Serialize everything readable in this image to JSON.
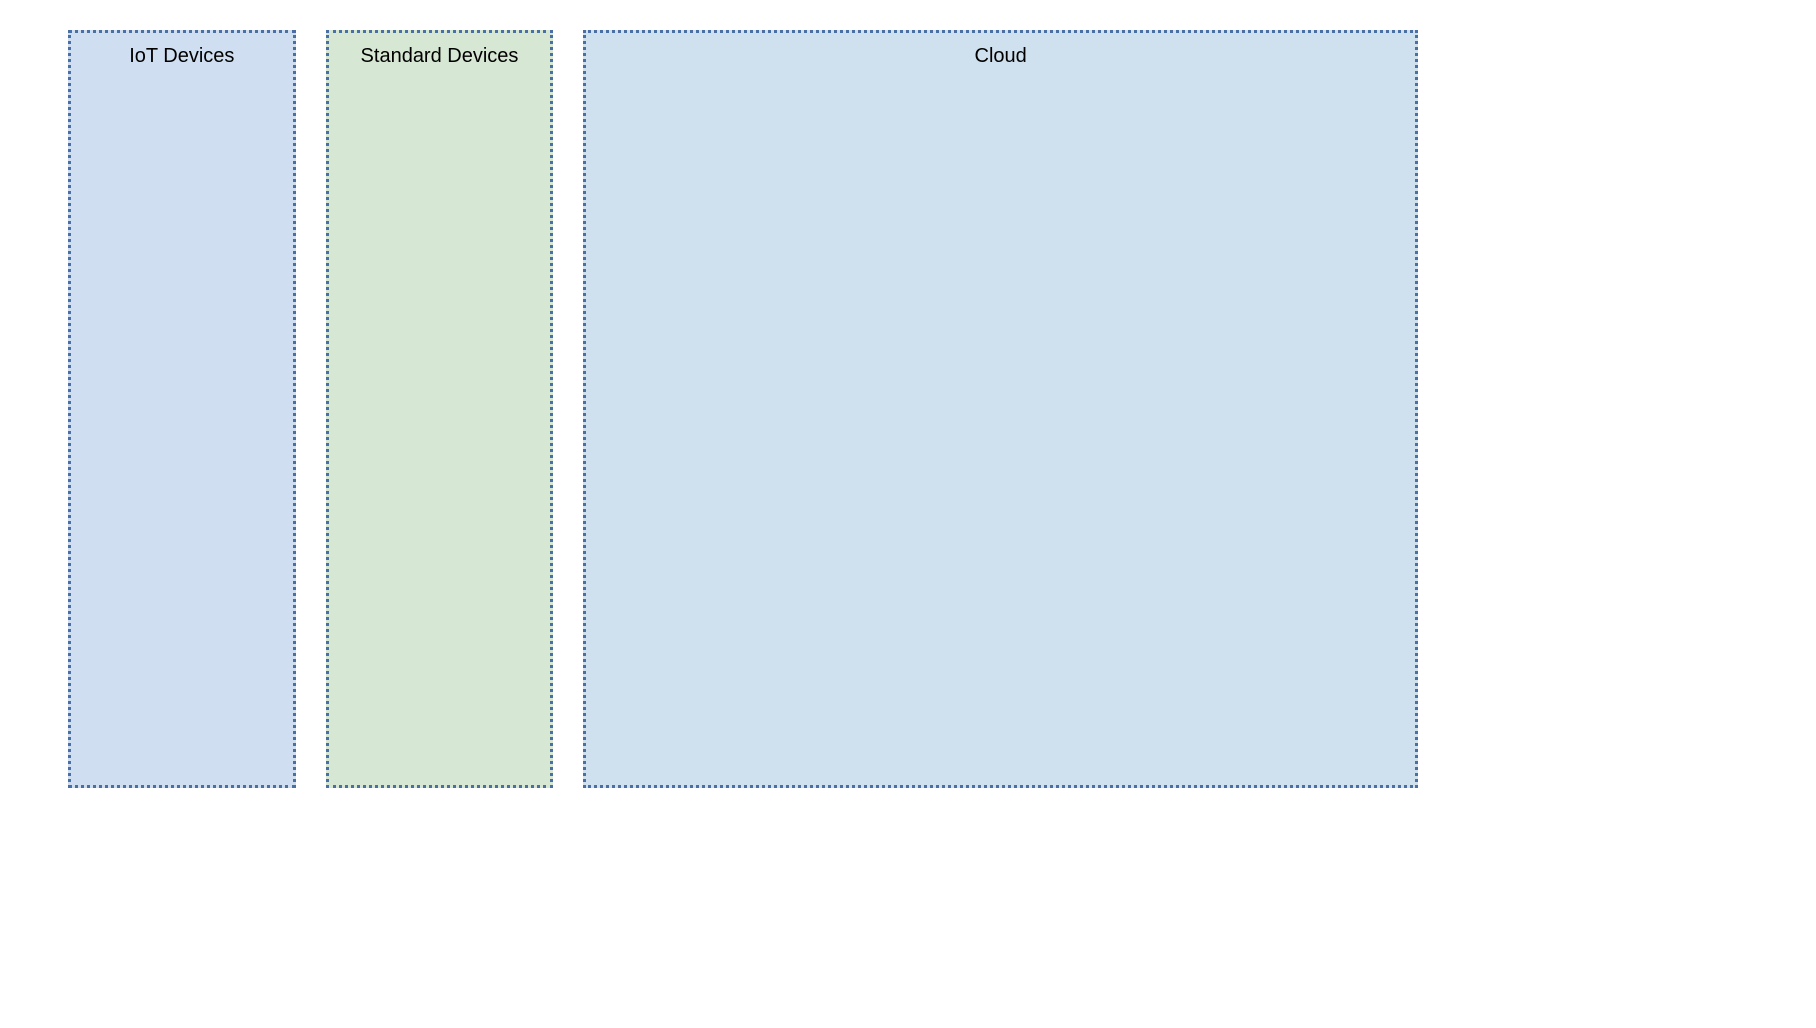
{
  "panels": {
    "iot": {
      "title": "IoT Devices",
      "background_color": "#cfdef1",
      "border_color": "#4a6fa5"
    },
    "standard": {
      "title": "Standard Devices",
      "background_color": "#d6e7d3",
      "border_color": "#4a6fa5"
    },
    "cloud": {
      "title": "Cloud",
      "background_color": "#cfe1ee",
      "border_color": "#4a6fa5"
    }
  }
}
